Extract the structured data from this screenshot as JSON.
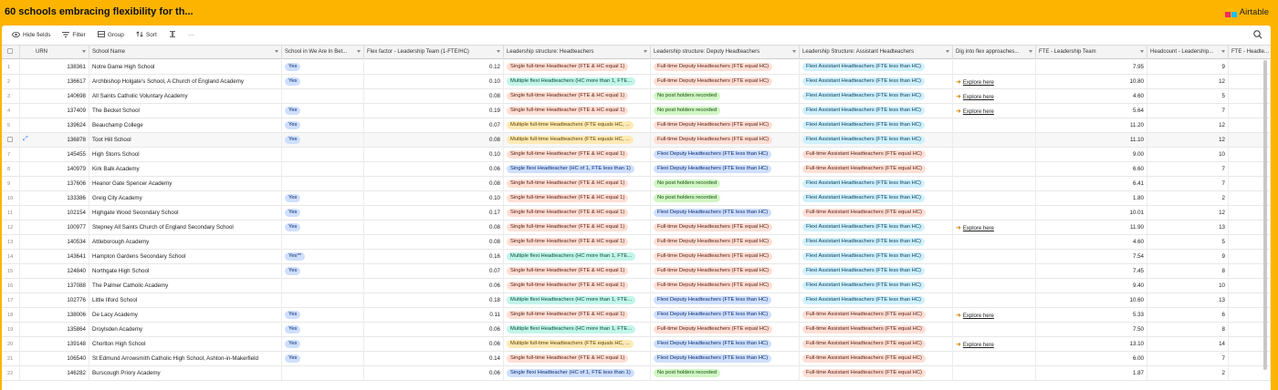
{
  "app": {
    "title": "60 schools embracing flexibility for th...",
    "brand": "Airtable",
    "brand_colors": [
      "#ffba05",
      "#18bfff",
      "#f82b60"
    ]
  },
  "toolbar": {
    "hide_fields": "Hide fields",
    "filter": "Filter",
    "group": "Group",
    "sort": "Sort",
    "more": "···"
  },
  "columns": {
    "urn": "URN",
    "school": "School Name",
    "waib": "School in We Are In Bet...",
    "flex": "Flex factor - Leadership Team (1-FTE/HC)",
    "ht": "Leadership structure: Headteachers",
    "dht": "Leadership structure: Deputy Headteachers",
    "aht": "Leadership Structure: Assistant Headteachers",
    "dig": "Dig into flex approaches...",
    "fte": "FTE - Leadership Team",
    "hc": "Headcount - Leadership...",
    "fte2": "FTE - Headte..."
  },
  "labels": {
    "yes": "Yes",
    "yes_star": "Yes**",
    "explore": "Explore here",
    "ht_single_ft": "Single full-time Headteacher (FTE & HC equal 1)",
    "ht_multi_flexi": "Multiple flexi Headteachers (HC more than 1, FTE...",
    "ht_multi_ft": "Multiple full-time Headteachers (FTE equals HC, ...",
    "ht_single_flexi": "Single flexi Headteacher (HC of 1, FTE less than 1)",
    "dht_ft": "Full-time Deputy Headteachers (FTE equal HC)",
    "dht_none": "No post holders recorded",
    "dht_flexi": "Flexi Deputy Headteachers (FTE less than HC)",
    "aht_flexi": "Flexi Assistant Headteachers (FTE less than HC)",
    "aht_ft": "Full-time Assistant Headteachers (FTE equal HC)"
  },
  "pill_colors": {
    "ht_single_ft": "p-or",
    "ht_multi_flexi": "p-te",
    "ht_multi_ft": "p-ye",
    "ht_single_flexi": "p-bl",
    "dht_ft": "p-or",
    "dht_none": "p-gr",
    "dht_flexi": "p-bl",
    "aht_flexi": "p-sk",
    "aht_ft": "p-or"
  },
  "rows": [
    {
      "n": "1",
      "urn": "138361",
      "school": "Notre Dame High School",
      "waib": "yes",
      "flex": "0.12",
      "ht": "ht_single_ft",
      "dht": "dht_ft",
      "aht": "aht_flexi",
      "dig": "",
      "fte": "7.95",
      "hc": "9"
    },
    {
      "n": "2",
      "urn": "136617",
      "school": "Archbishop Holgate's School, A Church of England Academy",
      "waib": "yes",
      "flex": "0.10",
      "ht": "ht_multi_flexi",
      "dht": "dht_ft",
      "aht": "aht_flexi",
      "dig": "explore",
      "fte": "10.80",
      "hc": "12"
    },
    {
      "n": "3",
      "urn": "140698",
      "school": "All Saints Catholic Voluntary Academy",
      "waib": "",
      "flex": "0.08",
      "ht": "ht_single_ft",
      "dht": "dht_none",
      "aht": "aht_flexi",
      "dig": "explore",
      "fte": "4.60",
      "hc": "5"
    },
    {
      "n": "4",
      "urn": "137409",
      "school": "The Becket School",
      "waib": "yes",
      "flex": "0.19",
      "ht": "ht_single_ft",
      "dht": "dht_none",
      "aht": "aht_flexi",
      "dig": "explore",
      "fte": "5.64",
      "hc": "7"
    },
    {
      "n": "5",
      "urn": "139624",
      "school": "Beauchamp College",
      "waib": "yes",
      "flex": "0.07",
      "ht": "ht_multi_ft",
      "dht": "dht_ft",
      "aht": "aht_flexi",
      "dig": "",
      "fte": "11.20",
      "hc": "12"
    },
    {
      "n": "6",
      "urn": "136878",
      "school": "Toot Hill School",
      "waib": "yes",
      "flex": "0.08",
      "ht": "ht_multi_ft",
      "dht": "dht_ft",
      "aht": "aht_flexi",
      "dig": "",
      "fte": "11.10",
      "hc": "12"
    },
    {
      "n": "7",
      "urn": "145455",
      "school": "High Storrs School",
      "waib": "",
      "flex": "0.10",
      "ht": "ht_single_ft",
      "dht": "dht_flexi",
      "aht": "aht_ft",
      "dig": "",
      "fte": "9.00",
      "hc": "10"
    },
    {
      "n": "8",
      "urn": "140979",
      "school": "Kirk Balk Academy",
      "waib": "",
      "flex": "0.06",
      "ht": "ht_single_flexi",
      "dht": "dht_flexi",
      "aht": "aht_ft",
      "dig": "",
      "fte": "6.60",
      "hc": "7"
    },
    {
      "n": "9",
      "urn": "137606",
      "school": "Heanor Gate Spencer Academy",
      "waib": "",
      "flex": "0.08",
      "ht": "ht_single_ft",
      "dht": "dht_none",
      "aht": "aht_flexi",
      "dig": "",
      "fte": "6.41",
      "hc": "7"
    },
    {
      "n": "10",
      "urn": "133386",
      "school": "Greig City Academy",
      "waib": "yes",
      "flex": "0.10",
      "ht": "ht_single_ft",
      "dht": "dht_none",
      "aht": "aht_flexi",
      "dig": "",
      "fte": "1.80",
      "hc": "2"
    },
    {
      "n": "11",
      "urn": "102154",
      "school": "Highgate Wood Secondary School",
      "waib": "yes",
      "flex": "0.17",
      "ht": "ht_single_ft",
      "dht": "dht_flexi",
      "aht": "aht_ft",
      "dig": "",
      "fte": "10.01",
      "hc": "12"
    },
    {
      "n": "12",
      "urn": "100977",
      "school": "Stepney All Saints Church of England Secondary School",
      "waib": "yes",
      "flex": "0.08",
      "ht": "ht_single_ft",
      "dht": "dht_ft",
      "aht": "aht_flexi",
      "dig": "explore",
      "fte": "11.90",
      "hc": "13"
    },
    {
      "n": "13",
      "urn": "140534",
      "school": "Attleborough Academy",
      "waib": "",
      "flex": "0.08",
      "ht": "ht_single_ft",
      "dht": "dht_ft",
      "aht": "aht_flexi",
      "dig": "",
      "fte": "4.60",
      "hc": "5"
    },
    {
      "n": "14",
      "urn": "143641",
      "school": "Hampton Gardens Secondary School",
      "waib": "yes_star",
      "flex": "0.16",
      "ht": "ht_multi_flexi",
      "dht": "dht_ft",
      "aht": "aht_flexi",
      "dig": "",
      "fte": "7.54",
      "hc": "9"
    },
    {
      "n": "15",
      "urn": "124840",
      "school": "Northgate High School",
      "waib": "yes",
      "flex": "0.07",
      "ht": "ht_single_ft",
      "dht": "dht_ft",
      "aht": "aht_flexi",
      "dig": "",
      "fte": "7.45",
      "hc": "8"
    },
    {
      "n": "16",
      "urn": "137088",
      "school": "The Palmer Catholic Academy",
      "waib": "",
      "flex": "0.06",
      "ht": "ht_single_ft",
      "dht": "dht_ft",
      "aht": "aht_flexi",
      "dig": "",
      "fte": "9.40",
      "hc": "10"
    },
    {
      "n": "17",
      "urn": "102776",
      "school": "Little Ilford School",
      "waib": "",
      "flex": "0.18",
      "ht": "ht_multi_flexi",
      "dht": "dht_flexi",
      "aht": "aht_flexi",
      "dig": "",
      "fte": "10.60",
      "hc": "13"
    },
    {
      "n": "18",
      "urn": "138006",
      "school": "De Lacy Academy",
      "waib": "yes",
      "flex": "0.11",
      "ht": "ht_single_ft",
      "dht": "dht_flexi",
      "aht": "aht_ft",
      "dig": "explore",
      "fte": "5.33",
      "hc": "6"
    },
    {
      "n": "19",
      "urn": "135864",
      "school": "Droylsden Academy",
      "waib": "yes",
      "flex": "0.06",
      "ht": "ht_multi_flexi",
      "dht": "dht_ft",
      "aht": "aht_ft",
      "dig": "",
      "fte": "7.50",
      "hc": "8"
    },
    {
      "n": "20",
      "urn": "139148",
      "school": "Chorlton High School",
      "waib": "yes",
      "flex": "0.06",
      "ht": "ht_multi_ft",
      "dht": "dht_flexi",
      "aht": "aht_ft",
      "dig": "explore",
      "fte": "13.10",
      "hc": "14"
    },
    {
      "n": "21",
      "urn": "106540",
      "school": "St Edmund Arrowsmith Catholic High School, Ashton-in-Makerfield",
      "waib": "yes",
      "flex": "0.14",
      "ht": "ht_single_ft",
      "dht": "dht_flexi",
      "aht": "aht_ft",
      "dig": "",
      "fte": "6.00",
      "hc": "7"
    },
    {
      "n": "22",
      "urn": "146282",
      "school": "Burscough Priory Academy",
      "waib": "",
      "flex": "0.06",
      "ht": "ht_single_flexi",
      "dht": "dht_none",
      "aht": "aht_ft",
      "dig": "",
      "fte": "1.87",
      "hc": "2"
    }
  ]
}
